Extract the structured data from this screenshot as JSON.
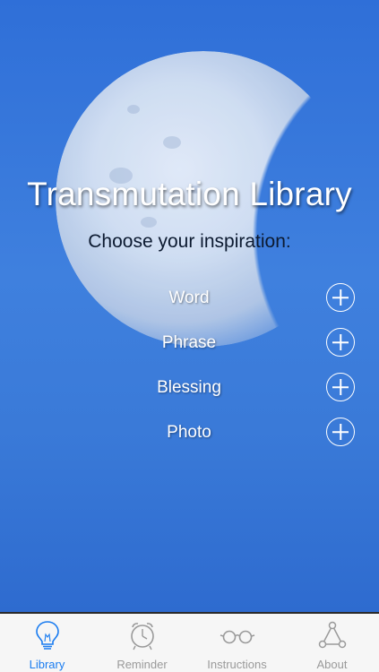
{
  "title": "Transmutation Library",
  "subtitle": "Choose your inspiration:",
  "items": [
    {
      "label": "Word"
    },
    {
      "label": "Phrase"
    },
    {
      "label": "Blessing"
    },
    {
      "label": "Photo"
    }
  ],
  "tabs": [
    {
      "label": "Library",
      "icon": "lightbulb-icon",
      "active": true
    },
    {
      "label": "Reminder",
      "icon": "alarm-clock-icon",
      "active": false
    },
    {
      "label": "Instructions",
      "icon": "glasses-icon",
      "active": false
    },
    {
      "label": "About",
      "icon": "network-triangle-icon",
      "active": false
    }
  ],
  "colors": {
    "accent": "#1a7cf0",
    "inactive": "#9a9a9a",
    "sky": "#3d7ad6"
  }
}
